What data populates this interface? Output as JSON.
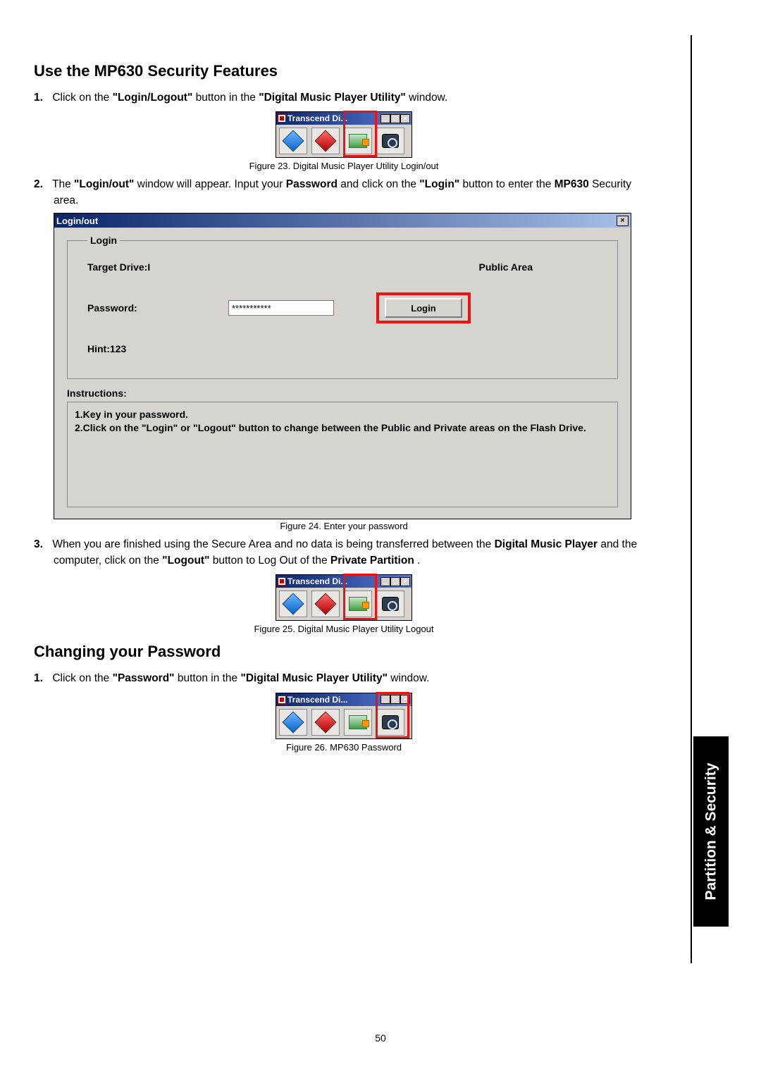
{
  "side_tab": "Partition & Security",
  "page_number": "50",
  "section1": {
    "title": "Use the MP630 Security Features",
    "step1": {
      "num": "1.",
      "pre": "Click on the ",
      "b1": "\"Login/Logout\"",
      "mid1": " button in the ",
      "b2": "\"Digital Music Player Utility\"",
      "post": " window."
    },
    "fig23": {
      "title": "Transcend Di...",
      "caption": "Figure 23. Digital Music Player Utility Login/out"
    },
    "step2": {
      "num": "2.",
      "t1": "The ",
      "b1": "\"Login/out\"",
      "t2": " window will appear. Input your ",
      "b2": "Password",
      "t3": " and click on the ",
      "b3": "\"Login\"",
      "t4": " button to enter the ",
      "b4": "MP630",
      "t5": " Security area."
    },
    "dlg": {
      "title": "Login/out",
      "legend": "Login",
      "target_drive": "Target Drive:I",
      "public_area": "Public Area",
      "password_label": "Password:",
      "password_value": "***********",
      "login_btn": "Login",
      "hint": "Hint:123",
      "instructions_label": "Instructions:",
      "instr_line1": "1.Key in your password.",
      "instr_line2": "2.Click on the \"Login\" or \"Logout\" button to change between the Public and Private areas on the Flash Drive."
    },
    "fig24_caption": "Figure 24. Enter your password",
    "step3": {
      "num": "3.",
      "t1": "When you are finished using the Secure Area and no data is being transferred between the ",
      "b1": "Digital Music Player",
      "t2": " and the computer, click on the ",
      "b2": "\"Logout\"",
      "t3": " button to Log Out of the ",
      "b3": "Private Partition",
      "t4": "."
    },
    "fig25": {
      "title": "Transcend Di...",
      "caption": "Figure 25. Digital Music Player Utility Logout"
    }
  },
  "section2": {
    "title": "Changing your Password",
    "step1": {
      "num": "1.",
      "pre": "Click on the ",
      "b1": "\"Password\"",
      "mid1": " button in the ",
      "b2": "\"Digital Music Player Utility\"",
      "post": " window."
    },
    "fig26": {
      "title": "Transcend Di...",
      "caption": "Figure 26. MP630 Password"
    }
  }
}
